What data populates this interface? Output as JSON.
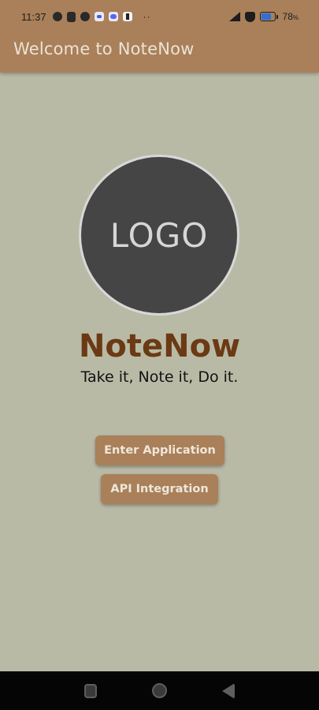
{
  "status_bar": {
    "time": "11:37",
    "dots": "··",
    "battery_percent": "78",
    "battery_suffix": "%",
    "battery_level": 0.78,
    "battery_color": "#2f6fd6",
    "icons": [
      "dnd-icon",
      "vibrate-icon",
      "clock-icon",
      "messenger-icon",
      "discord-icon",
      "run-icon",
      "signal-icon",
      "shield-icon",
      "battery-icon"
    ]
  },
  "app_bar": {
    "title": "Welcome to NoteNow",
    "background": "#a98059"
  },
  "logo": {
    "text": "LOGO"
  },
  "brand": {
    "name": "NoteNow",
    "tagline": "Take it, Note it, Do it.",
    "name_color": "#6b3a14"
  },
  "buttons": {
    "enter_label": "Enter Application",
    "api_label": "API Integration"
  },
  "nav_bar": {
    "icons": [
      "recents-icon",
      "home-icon",
      "back-icon"
    ]
  },
  "colors": {
    "page_background": "#b9baa6",
    "accent": "#a98059"
  }
}
